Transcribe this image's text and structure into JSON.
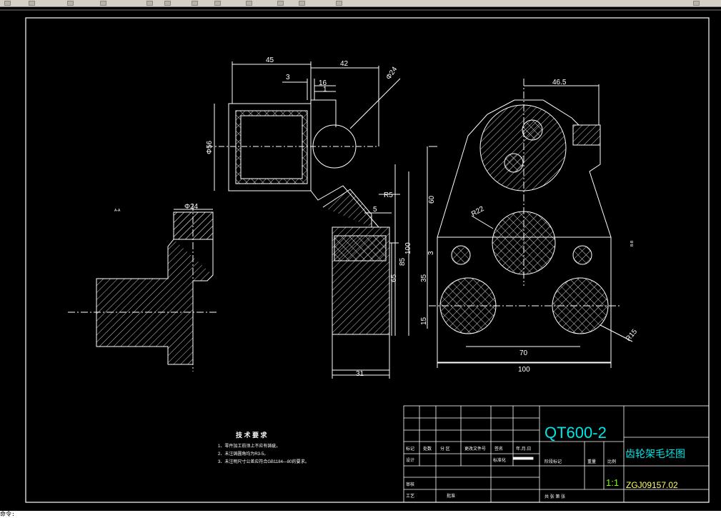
{
  "toolbar": {
    "items": [
      "undo-icon",
      "redo-icon",
      "pan-icon",
      "zoom-realtime-icon",
      "zoom-window-icon",
      "zoom-previous-icon",
      "properties-icon",
      "design-center-icon",
      "tool-palettes-icon",
      "sheet-set-icon",
      "markup-icon",
      "calculator-icon",
      "help-icon"
    ]
  },
  "drawing": {
    "colors": {
      "background": "#000000",
      "lines": "#ffffff",
      "dims": "#ffffff",
      "title_material": "#00e5e5",
      "title_scale": "#7fff00",
      "title_code": "#ffff66"
    },
    "dims": {
      "d45": "45",
      "d42": "42",
      "d3": "3",
      "d16": "16",
      "d1": "1",
      "phi24_top": "Φ24",
      "phi56": "Φ56",
      "r5": "R5",
      "d5": "5",
      "d100_v": "100",
      "d85": "85",
      "d65": "65",
      "d31": "31",
      "phi24_left": "Φ24",
      "d46_5": "46.5",
      "d60": "60",
      "r22": "R22",
      "d3_v": "3",
      "d35": "35",
      "d15": "15",
      "d70": "70",
      "d100_h": "100",
      "r15": "R15"
    },
    "section_label_left": "A-A",
    "section_label_right": "B-B"
  },
  "tech_requirements": {
    "title": "技 术 要 求",
    "items": [
      "1、零件加工前须上不应有铸疵。",
      "2、未注铸圆角均为R3-5。",
      "3、未注明尺寸公差应符合GB1184—80的要求。"
    ]
  },
  "title_block": {
    "material": "QT600-2",
    "part_name": "齿轮架毛坯图",
    "scale": "1:1",
    "drawing_code": "ZGJ09157.02",
    "labels": {
      "biaoji": "标记",
      "chushu": "处数",
      "fenqu": "分 区",
      "gengai": "更改文件号",
      "qianming": "签名",
      "nianyueri": "年.月.日",
      "sheji": "设计",
      "biaozhunhua": "标准化",
      "jieduan": "阶段标记",
      "zhongliang": "重量",
      "bili": "比例",
      "shenhe": "审核",
      "gongyi": "工艺",
      "pizhun": "批准",
      "gong_zhang": "共 张 第 张"
    }
  },
  "status": {
    "text": "命令:"
  }
}
